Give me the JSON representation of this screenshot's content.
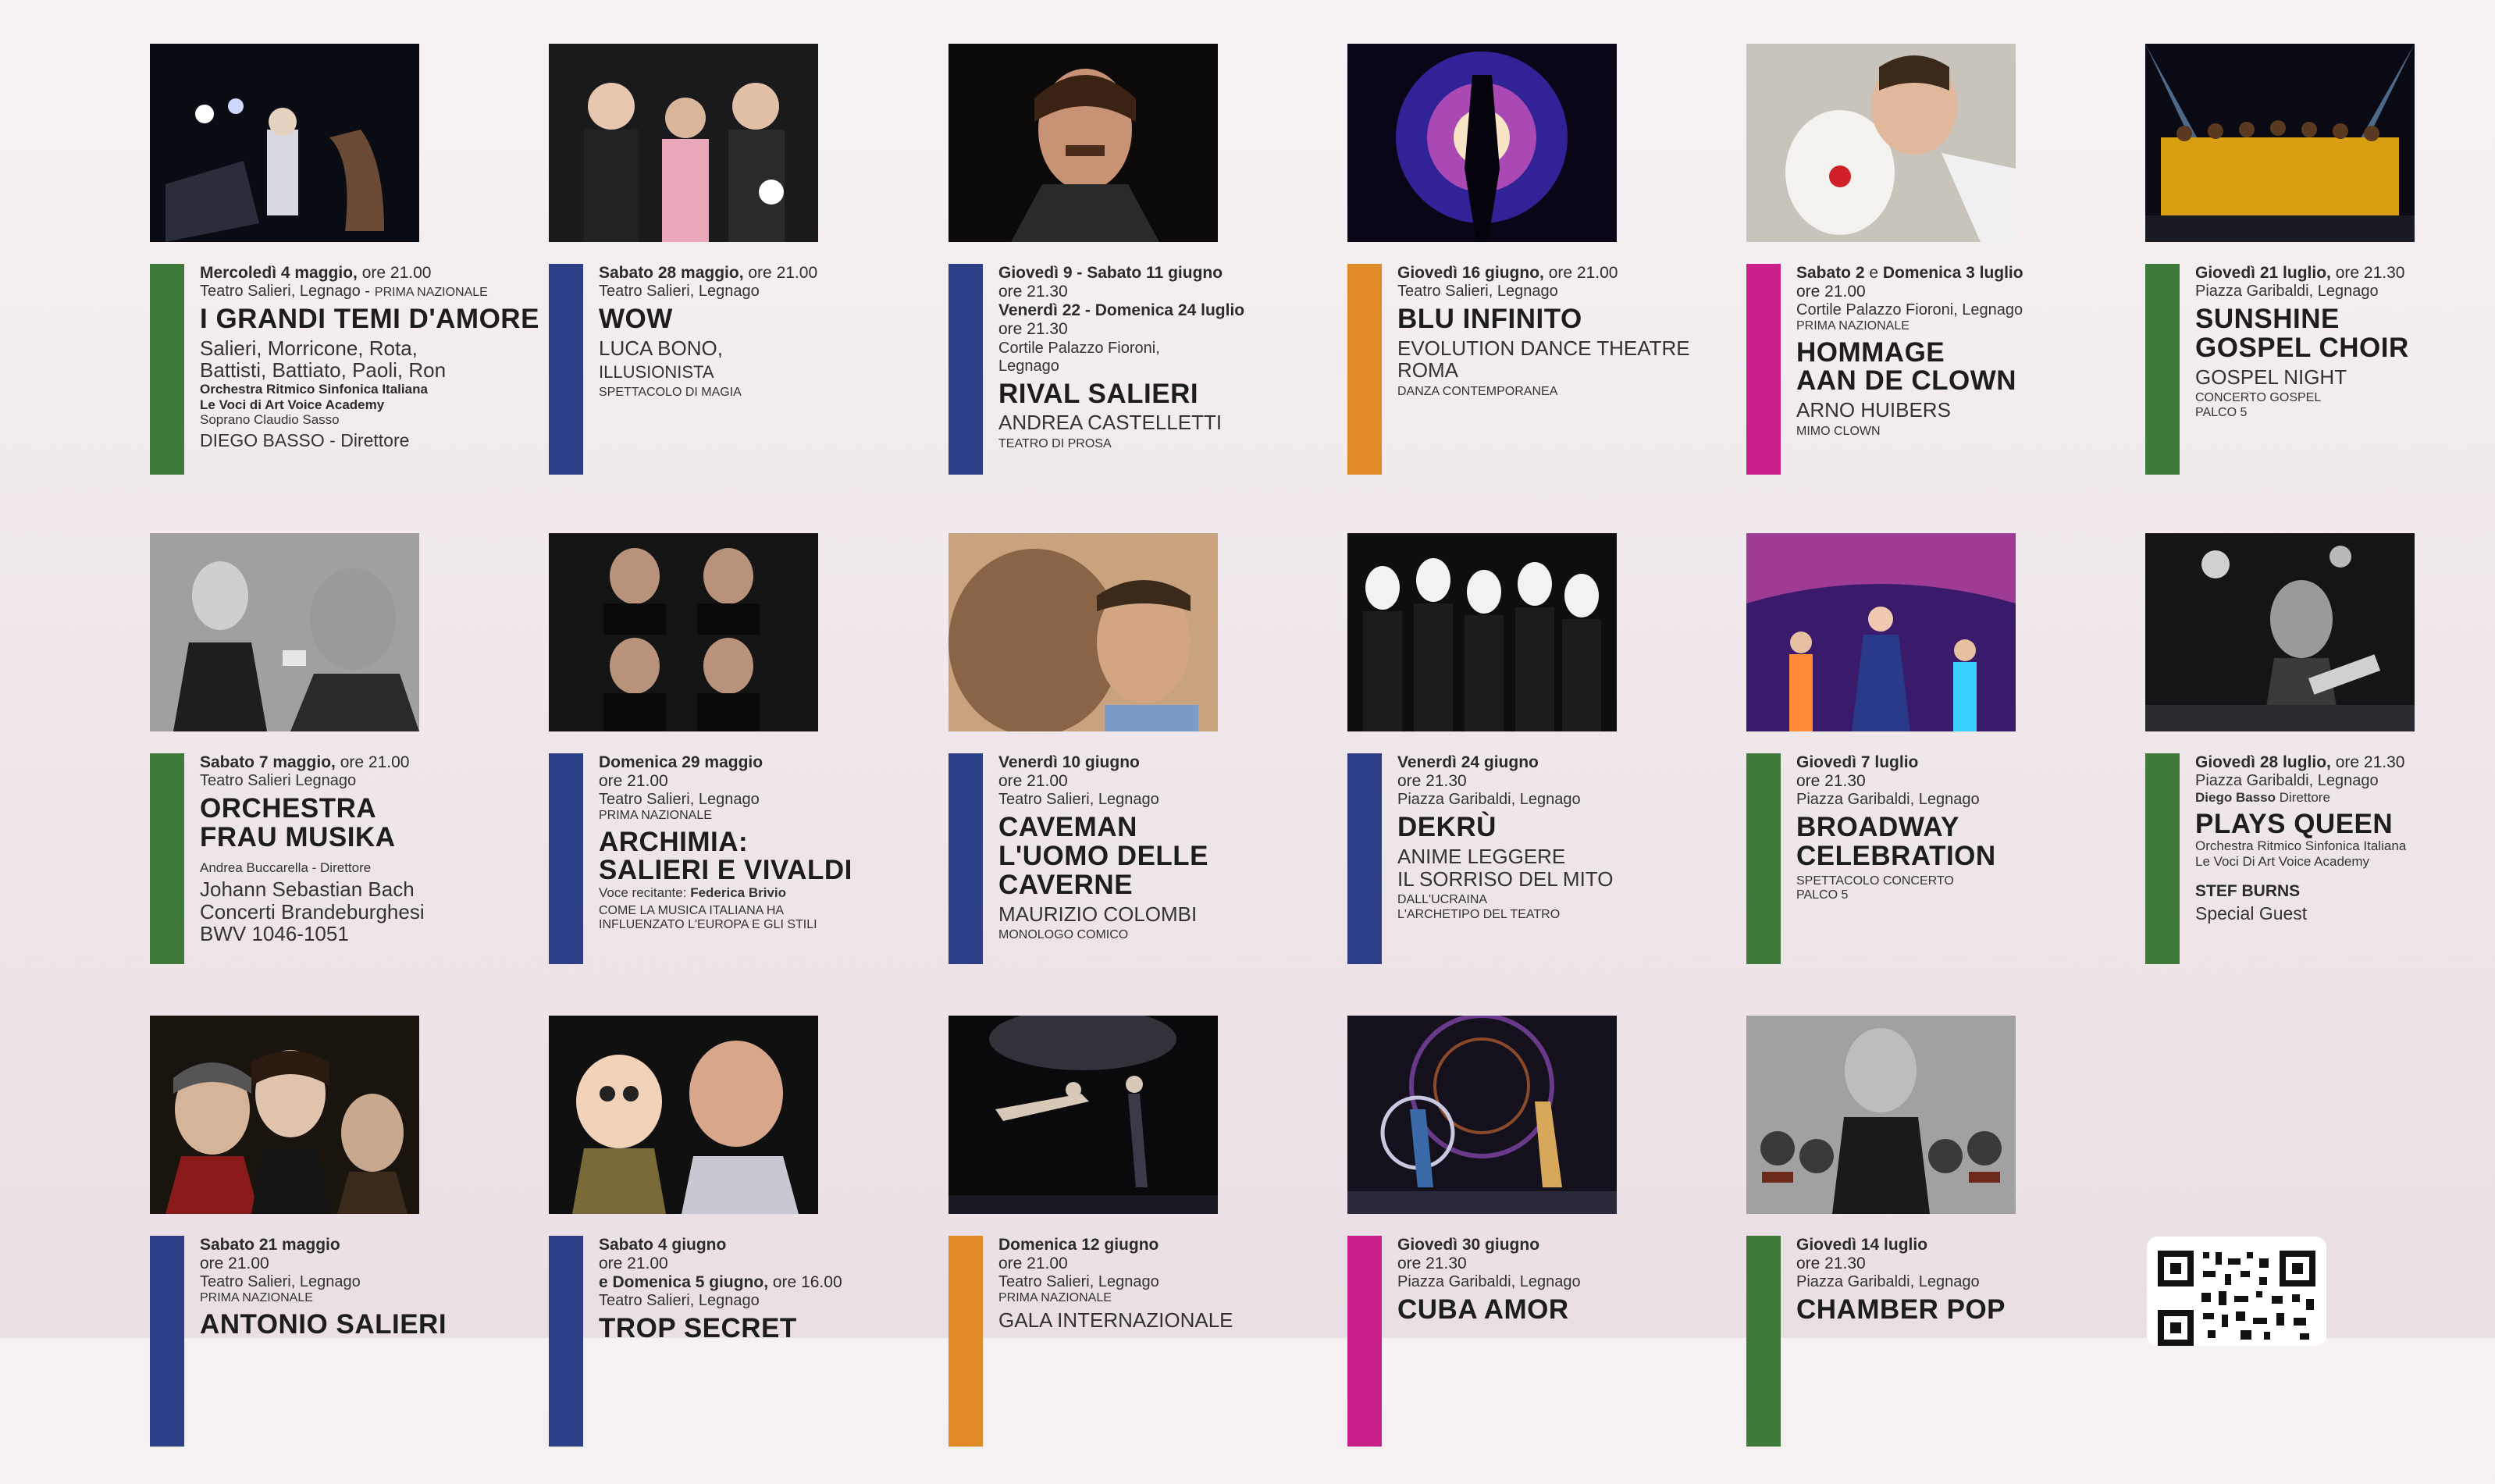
{
  "colors": {
    "green": "#3f7a3a",
    "blue": "#2e3f8a",
    "orange": "#e08a28",
    "magenta": "#c9208a"
  },
  "events": [
    {
      "date_bold": "Mercoledì 4 maggio,",
      "date_rest": " ore 21.00",
      "venue": "Teatro Salieri, Legnago -",
      "tag": "PRIMA NAZIONALE",
      "title": "I GRANDI TEMI D'AMORE",
      "sub": "Salieri, Morricone, Rota,\nBattisti, Battiato, Paoli, Ron",
      "details_bold": "Orchestra Ritmico Sinfonica Italiana\nLe Voci di Art Voice Academy",
      "details": "Soprano Claudio Sasso",
      "footer": "DIEGO BASSO - Direttore",
      "bar": "green",
      "photo_icon": "orchestra-photo"
    },
    {
      "date_bold": "Sabato 28 maggio,",
      "date_rest": " ore 21.00",
      "venue": "Teatro Salieri, Legnago",
      "title": "WOW",
      "sub": "LUCA BONO,",
      "details": "ILLUSIONISTA",
      "note": "SPETTACOLO DI MAGIA",
      "bar": "blue",
      "photo_icon": "magicians-photo"
    },
    {
      "date_bold": "Giovedì 9 - Sabato 11 giugno",
      "date_rest": "\nore 21.30",
      "date2_bold": "Venerdì 22 - Domenica 24 luglio",
      "date2_rest": "\nore 21.30",
      "venue": "Cortile Palazzo Fioroni,\nLegnago",
      "title": "RIVAL SALIERI",
      "sub": "ANDREA CASTELLETTI",
      "note": "TEATRO DI PROSA",
      "bar": "blue",
      "photo_icon": "actor-photo"
    },
    {
      "date_bold": "Giovedì 16 giugno,",
      "date_rest": " ore 21.00",
      "venue": "Teatro Salieri, Legnago",
      "title": "BLU INFINITO",
      "sub": "EVOLUTION DANCE THEATRE\nROMA",
      "note": "DANZA CONTEMPORANEA",
      "bar": "orange",
      "photo_icon": "dancer-light-photo"
    },
    {
      "date_bold": "Sabato 2",
      "date_rest": " e ",
      "date_bold2": "Domenica 3 luglio",
      "date_rest2": "\nore 21.00",
      "venue": "Cortile Palazzo Fioroni, Legnago",
      "tag": "PRIMA NAZIONALE",
      "title": "HOMMAGE\nAAN DE CLOWN",
      "sub": "ARNO HUIBERS",
      "note": "MIMO CLOWN",
      "bar": "magenta",
      "photo_icon": "clown-photo"
    },
    {
      "date_bold": "Giovedì 21 luglio,",
      "date_rest": " ore 21.30",
      "venue": "Piazza Garibaldi, Legnago",
      "title": "SUNSHINE\nGOSPEL CHOIR",
      "sub": "GOSPEL NIGHT",
      "note": "CONCERTO GOSPEL\nPALCO 5",
      "bar": "green",
      "photo_icon": "choir-photo"
    },
    {
      "date_bold": "Sabato 7 maggio,",
      "date_rest": " ore 21.00",
      "venue": "Teatro Salieri Legnago",
      "title": "ORCHESTRA\nFRAU MUSIKA",
      "details": "Andrea Buccarella - Direttore",
      "sub": "Johann Sebastian Bach\nConcerti Brandeburghesi\nBWV 1046-1051",
      "bar": "green",
      "photo_icon": "conductor-photo"
    },
    {
      "date_bold": "Domenica 29 maggio",
      "date_rest": "\nore 21.00",
      "venue": "Teatro Salieri, Legnago",
      "tag": "PRIMA NAZIONALE",
      "title": "ARCHIMIA:\nSALIERI E VIVALDI",
      "note": "COME LA MUSICA ITALIANA HA\nINFLUENZATO L'EUROPA E GLI STILI",
      "details": "Voce recitante: ",
      "details_b": "Federica Brivio",
      "bar": "blue",
      "photo_icon": "quartet-photo"
    },
    {
      "date_bold": "Venerdì 10 giugno",
      "date_rest": "\nore 21.00",
      "venue": "Teatro Salieri, Legnago",
      "title": "CAVEMAN\nL'UOMO DELLE\nCAVERNE",
      "sub": "MAURIZIO COLOMBI",
      "note": "MONOLOGO COMICO",
      "bar": "blue",
      "photo_icon": "caveman-photo"
    },
    {
      "date_bold": "Venerdì 24 giugno",
      "date_rest": "\nore 21.30",
      "venue": "Piazza Garibaldi, Legnago",
      "title": "DEKRÙ",
      "sub": "ANIME LEGGERE\nIL SORRISO DEL MITO",
      "note": "DALL'UCRAINA\nL'ARCHETIPO DEL TEATRO",
      "bar": "blue",
      "photo_icon": "mimes-photo"
    },
    {
      "date_bold": "Giovedì 7 luglio",
      "date_rest": "\nore 21.30",
      "venue": "Piazza Garibaldi, Legnago",
      "title": "BROADWAY\nCELEBRATION",
      "note": "SPETTACOLO CONCERTO\nPALCO 5",
      "bar": "green",
      "photo_icon": "broadway-photo"
    },
    {
      "date_bold": "Giovedì 28 luglio,",
      "date_rest": " ore 21.30",
      "venue": "Piazza Garibaldi, Legnago",
      "details_b": "Diego Basso",
      "details": " Direttore",
      "title": "PLAYS QUEEN",
      "small2": "Orchestra Ritmico Sinfonica Italiana\nLe Voci Di Art Voice Academy",
      "footer_b": "STEF BURNS",
      "footer": "Special Guest",
      "bar": "green",
      "photo_icon": "rock-band-photo"
    },
    {
      "date_bold": "Sabato 21 maggio",
      "date_rest": "\nore 21.00",
      "venue": "Teatro Salieri, Legnago",
      "tag": "PRIMA NAZIONALE",
      "title": "ANTONIO SALIERI",
      "bar": "blue",
      "photo_icon": "composers-photo"
    },
    {
      "date_bold": "Sabato 4 giugno",
      "date_rest": "\nore 21.00",
      "date2_bold": "e Domenica 5 giugno,",
      "date2_rest": " ore 16.00",
      "venue": "Teatro Salieri, Legnago",
      "title": "TROP SECRET",
      "bar": "blue",
      "photo_icon": "puppet-photo"
    },
    {
      "date_bold": "Domenica 12 giugno",
      "date_rest": "\nore 21.00",
      "venue": "Teatro Salieri, Legnago",
      "tag": "PRIMA NAZIONALE",
      "sub": "GALA INTERNAZIONALE",
      "bar": "orange",
      "photo_icon": "ballet-photo"
    },
    {
      "date_bold": "Giovedì 30 giugno",
      "date_rest": "\nore 21.30",
      "venue": "Piazza Garibaldi, Legnago",
      "title": "CUBA AMOR",
      "bar": "magenta",
      "photo_icon": "circus-photo"
    },
    {
      "date_bold": "Giovedì 14 luglio",
      "date_rest": "\nore 21.30",
      "venue": "Piazza Garibaldi, Legnago",
      "title": "CHAMBER POP",
      "bar": "green",
      "photo_icon": "violinist-photo"
    }
  ],
  "qr": {
    "icon": "qr-code-icon"
  }
}
